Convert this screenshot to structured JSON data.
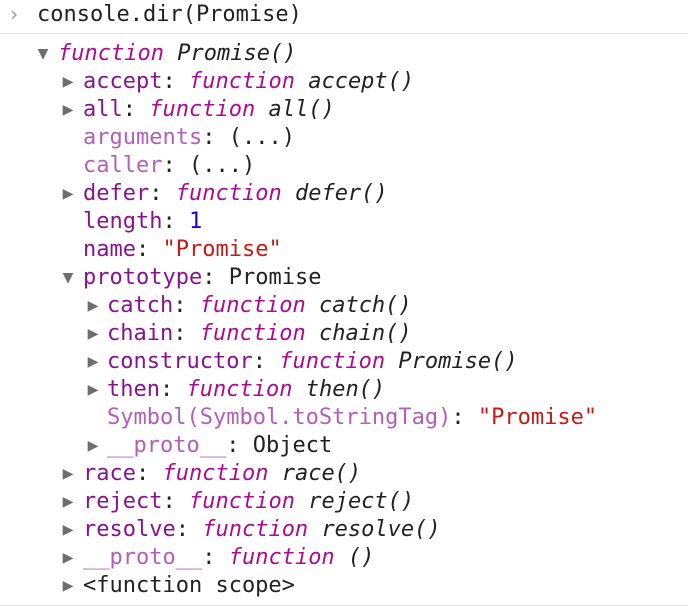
{
  "console": {
    "prompt_glyph": "›",
    "input": "console.dir(Promise)"
  },
  "tree": {
    "root": {
      "keyword": "function",
      "name": "Promise()"
    },
    "props": {
      "accept": {
        "key": "accept",
        "keyword": "function",
        "value": "accept()"
      },
      "all": {
        "key": "all",
        "keyword": "function",
        "value": "all()"
      },
      "arguments": {
        "key": "arguments",
        "value": "(...)"
      },
      "caller": {
        "key": "caller",
        "value": "(...)"
      },
      "defer": {
        "key": "defer",
        "keyword": "function",
        "value": "defer()"
      },
      "length": {
        "key": "length",
        "value": "1"
      },
      "name": {
        "key": "name",
        "value": "\"Promise\""
      },
      "prototype": {
        "key": "prototype",
        "value": "Promise",
        "children": {
          "catch": {
            "key": "catch",
            "keyword": "function",
            "value": "catch()"
          },
          "chain": {
            "key": "chain",
            "keyword": "function",
            "value": "chain()"
          },
          "constructor": {
            "key": "constructor",
            "keyword": "function",
            "value": "Promise()"
          },
          "then": {
            "key": "then",
            "keyword": "function",
            "value": "then()"
          },
          "symbol": {
            "key": "Symbol(Symbol.toStringTag)",
            "value": "\"Promise\""
          },
          "proto": {
            "key": "__proto__",
            "value": "Object"
          }
        }
      },
      "race": {
        "key": "race",
        "keyword": "function",
        "value": "race()"
      },
      "reject": {
        "key": "reject",
        "keyword": "function",
        "value": "reject()"
      },
      "resolve": {
        "key": "resolve",
        "keyword": "function",
        "value": "resolve()"
      },
      "proto": {
        "key": "__proto__",
        "keyword": "function",
        "value": "()"
      },
      "scope": {
        "label": "<function scope>"
      }
    }
  },
  "glyphs": {
    "expanded": "▼",
    "collapsed": "▶"
  },
  "colors": {
    "key": "#881391",
    "function_keyword": "#aa0d91",
    "number": "#1c00cf",
    "string": "#c41a16"
  }
}
